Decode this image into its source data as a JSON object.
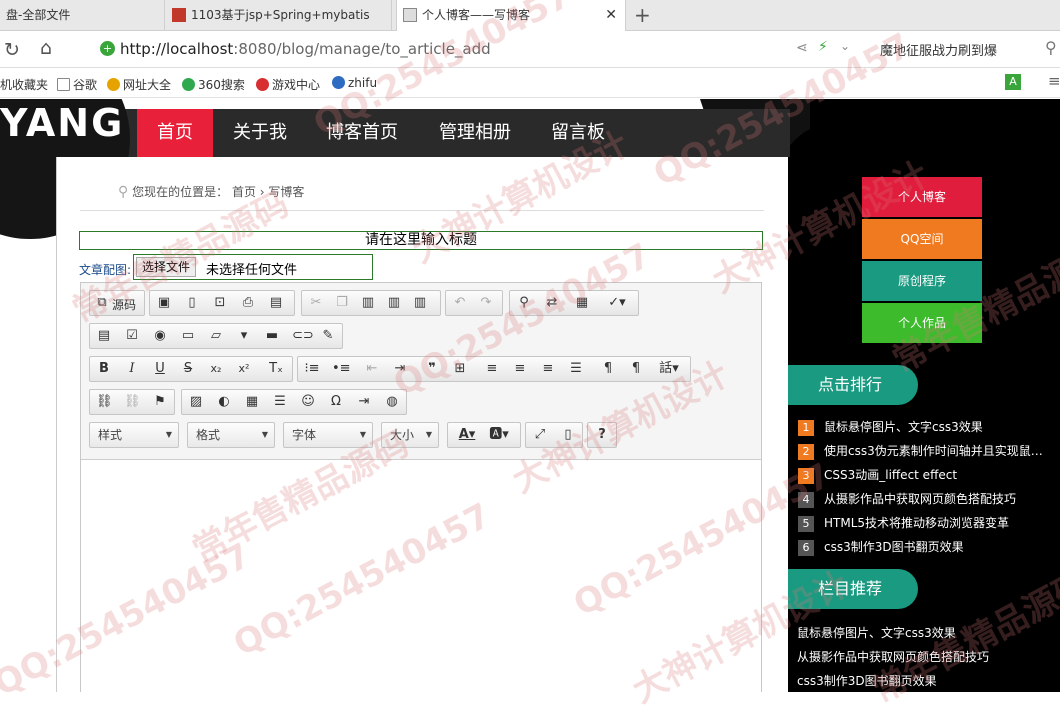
{
  "browser": {
    "tabs": [
      {
        "label": "盘-全部文件"
      },
      {
        "label": "1103基于jsp+Spring+mybatis"
      },
      {
        "label": "个人博客——写博客"
      }
    ],
    "new_tab": "+",
    "url_host": "http://localhost",
    "url_rest": ":8080/blog/manage/to_article_add",
    "search_hint": "魔地征服战力刷到爆",
    "bookmarks": [
      "机收藏夹",
      "谷歌",
      "网址大全",
      "360搜索",
      "游戏中心",
      "zhifu"
    ]
  },
  "site": {
    "logo": "YANG",
    "nav": [
      "首页",
      "关于我",
      "博客首页",
      "管理相册",
      "留言板"
    ],
    "location_label": "您现在的位置是：",
    "location_home": "首页",
    "location_sep": " › ",
    "location_current": "写博客"
  },
  "form": {
    "title_placeholder": "请在这里输入标题",
    "image_label": "文章配图:",
    "file_button": "选择文件",
    "file_status": "未选择任何文件"
  },
  "editor": {
    "source_label": "源码",
    "combos": [
      "样式",
      "格式",
      "字体",
      "大小"
    ]
  },
  "sidebar": {
    "buttons": [
      {
        "label": "个人博客",
        "color": "#e01d3c"
      },
      {
        "label": "QQ空间",
        "color": "#f07a20"
      },
      {
        "label": "原创程序",
        "color": "#1a9a80"
      },
      {
        "label": "个人作品",
        "color": "#3dbb2d"
      }
    ],
    "ranking_title": "点击排行",
    "ranking": [
      {
        "n": "1",
        "t": "鼠标悬停图片、文字css3效果"
      },
      {
        "n": "2",
        "t": "使用css3伪元素制作时间轴并且实现鼠…"
      },
      {
        "n": "3",
        "t": "CSS3动画_liffect effect"
      },
      {
        "n": "4",
        "t": "从摄影作品中获取网页颜色搭配技巧"
      },
      {
        "n": "5",
        "t": "HTML5技术将推动移动浏览器变革"
      },
      {
        "n": "6",
        "t": "css3制作3D图书翻页效果"
      }
    ],
    "recommend_title": "栏目推荐",
    "recommend": [
      "鼠标悬停图片、文字css3效果",
      "从摄影作品中获取网页颜色搭配技巧",
      "css3制作3D图书翻页效果"
    ]
  },
  "watermark": [
    "QQ:254540457",
    "大神计算机设计",
    "常年售精品源码"
  ]
}
